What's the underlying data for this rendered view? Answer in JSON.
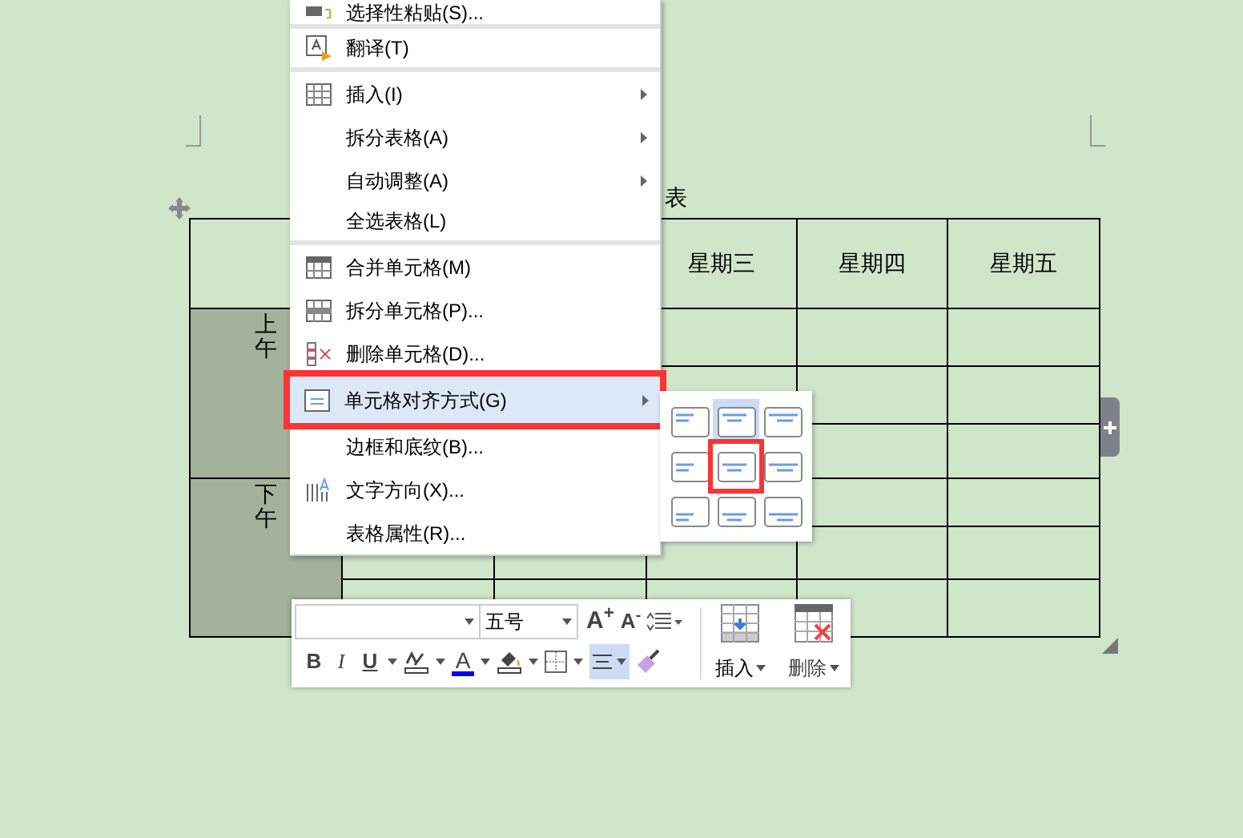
{
  "table": {
    "title": "表",
    "header": [
      "星期三",
      "星期四",
      "星期五"
    ],
    "periods": [
      {
        "label": "上午",
        "selected": true
      },
      {
        "label": "下午",
        "selected": true
      }
    ]
  },
  "context_menu": {
    "items": [
      {
        "label": "选择性粘贴(S)...",
        "submenu": false,
        "selected": false,
        "marked": false,
        "separator_after": true
      },
      {
        "label": "翻译(T)",
        "submenu": false,
        "selected": false,
        "marked": false,
        "separator_after": true
      },
      {
        "label": "插入(I)",
        "submenu": true,
        "selected": false,
        "marked": false,
        "separator_after": false
      },
      {
        "label": "拆分表格(A)",
        "submenu": true,
        "selected": false,
        "marked": false,
        "separator_after": false
      },
      {
        "label": "自动调整(A)",
        "submenu": true,
        "selected": false,
        "marked": false,
        "separator_after": false
      },
      {
        "label": "全选表格(L)",
        "submenu": false,
        "selected": false,
        "marked": false,
        "separator_after": true
      },
      {
        "label": "合并单元格(M)",
        "submenu": false,
        "selected": false,
        "marked": false,
        "separator_after": false
      },
      {
        "label": "拆分单元格(P)...",
        "submenu": false,
        "selected": false,
        "marked": false,
        "separator_after": false
      },
      {
        "label": "删除单元格(D)...",
        "submenu": false,
        "selected": false,
        "marked": false,
        "separator_after": false
      },
      {
        "label": "单元格对齐方式(G)",
        "submenu": true,
        "selected": true,
        "marked": true,
        "separator_after": false
      },
      {
        "label": "边框和底纹(B)...",
        "submenu": false,
        "selected": false,
        "marked": false,
        "separator_after": false
      },
      {
        "label": "文字方向(X)...",
        "submenu": false,
        "selected": false,
        "marked": false,
        "separator_after": false
      },
      {
        "label": "表格属性(R)...",
        "submenu": false,
        "selected": false,
        "marked": false,
        "separator_after": false
      }
    ]
  },
  "alignment_grid": [
    {
      "selected": false,
      "marked": false
    },
    {
      "selected": true,
      "marked": false
    },
    {
      "selected": false,
      "marked": false
    },
    {
      "selected": false,
      "marked": false
    },
    {
      "selected": false,
      "marked": true
    },
    {
      "selected": false,
      "marked": false
    },
    {
      "selected": false,
      "marked": false
    },
    {
      "selected": false,
      "marked": false
    },
    {
      "selected": false,
      "marked": false
    }
  ],
  "toolbar": {
    "font_size": "五号",
    "grow_font": "A$^{+}$",
    "shrink_font": "A$^{-}$",
    "bold": "B",
    "italic": "I",
    "underline": "U",
    "font_color": "A",
    "align_selected": true,
    "insert": "插入",
    "delete": "删除"
  }
}
